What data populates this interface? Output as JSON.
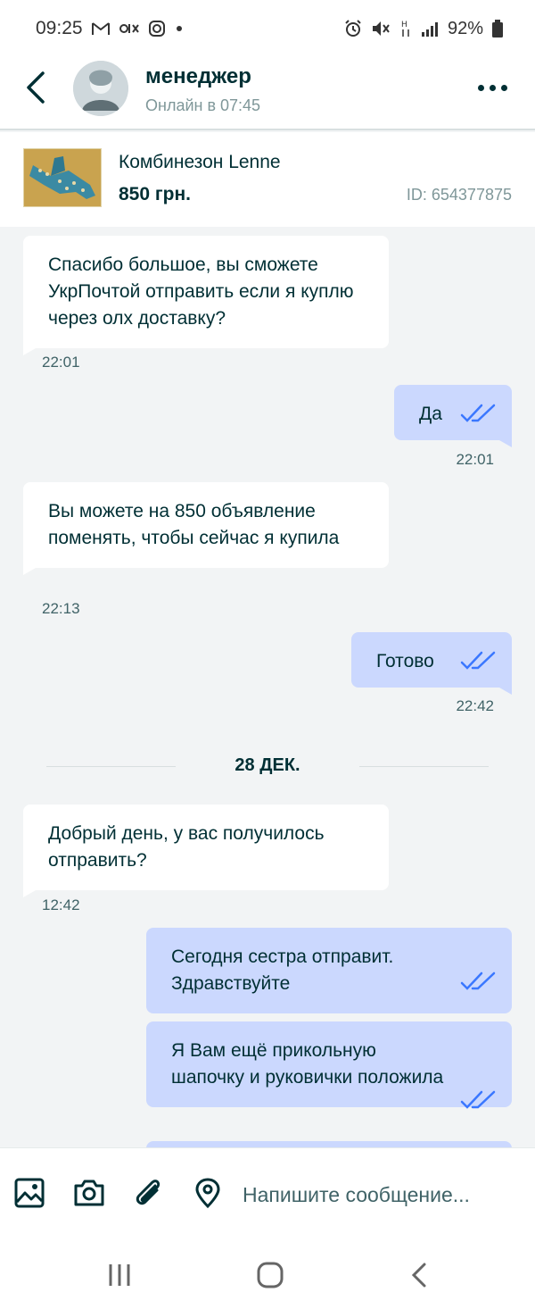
{
  "status_bar": {
    "time": "09:25",
    "battery": "92%",
    "left_icons": [
      "gmail-icon",
      "olx-icon",
      "instagram-icon",
      "dot-icon"
    ],
    "right_icons": [
      "alarm-icon",
      "mute-icon",
      "data-icon",
      "signal-icon",
      "battery-icon"
    ]
  },
  "header": {
    "contact_name": "менеджер",
    "contact_status": "Онлайн в 07:45"
  },
  "product": {
    "title": "Комбинезон Lenne",
    "price": "850 грн.",
    "id": "ID: 654377875"
  },
  "messages": [
    {
      "direction": "in",
      "text": "Спасибо большое, вы сможете УкрПочтой отправить если я куплю через олх доставку?",
      "time": "22:01"
    },
    {
      "direction": "out",
      "text": "Да",
      "time": "22:01",
      "read": true
    },
    {
      "direction": "in",
      "text": "Вы можете на 850 объявление поменять, чтобы сейчас я купила",
      "time": "22:13"
    },
    {
      "direction": "out",
      "text": "Готово",
      "time": "22:42",
      "read": true
    },
    {
      "direction": "in",
      "text": "Добрый день, у вас получилось отправить?",
      "time": "12:42"
    },
    {
      "direction": "out",
      "text": "Сегодня сестра отправит. Здравствуйте",
      "read": true
    },
    {
      "direction": "out",
      "text": "Я Вам ещё прикольную шапочку и руковички положила",
      "read": true
    }
  ],
  "date_separator": "28 ДЕК.",
  "input": {
    "placeholder": "Напишите сообщение..."
  },
  "colors": {
    "accent": "#002f34",
    "outgoing_bubble": "#cbd8fe",
    "incoming_bubble": "#ffffff",
    "read_check": "#3a77ff",
    "background": "#f2f4f5"
  }
}
